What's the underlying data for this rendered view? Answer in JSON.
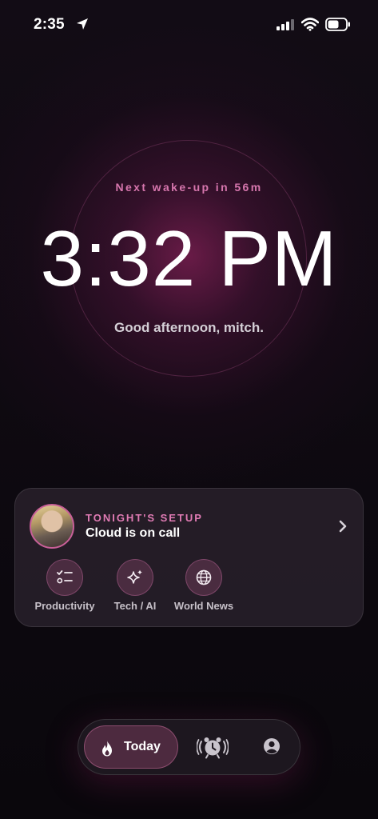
{
  "status_bar": {
    "time": "2:35",
    "icons": [
      "location-arrow-icon",
      "cellular-signal-icon",
      "wifi-icon",
      "battery-icon"
    ]
  },
  "clock": {
    "next_wake": "Next wake-up in 56m",
    "time": "3:32 PM",
    "greeting": "Good afternoon, mitch."
  },
  "setup_card": {
    "label": "TONIGHT'S SETUP",
    "title": "Cloud is on call",
    "avatar_icon": "character-avatar",
    "topics": [
      {
        "label": "Productivity",
        "icon": "checklist-icon"
      },
      {
        "label": "Tech / AI",
        "icon": "sparkles-icon"
      },
      {
        "label": "World News",
        "icon": "globe-icon"
      }
    ]
  },
  "tab_bar": {
    "today_label": "Today",
    "tabs": [
      "flame-icon",
      "alarm-clock-icon",
      "profile-icon"
    ]
  },
  "colors": {
    "accent_pink": "#e07bb4",
    "background": "#0b080d",
    "card": "#261e28"
  }
}
